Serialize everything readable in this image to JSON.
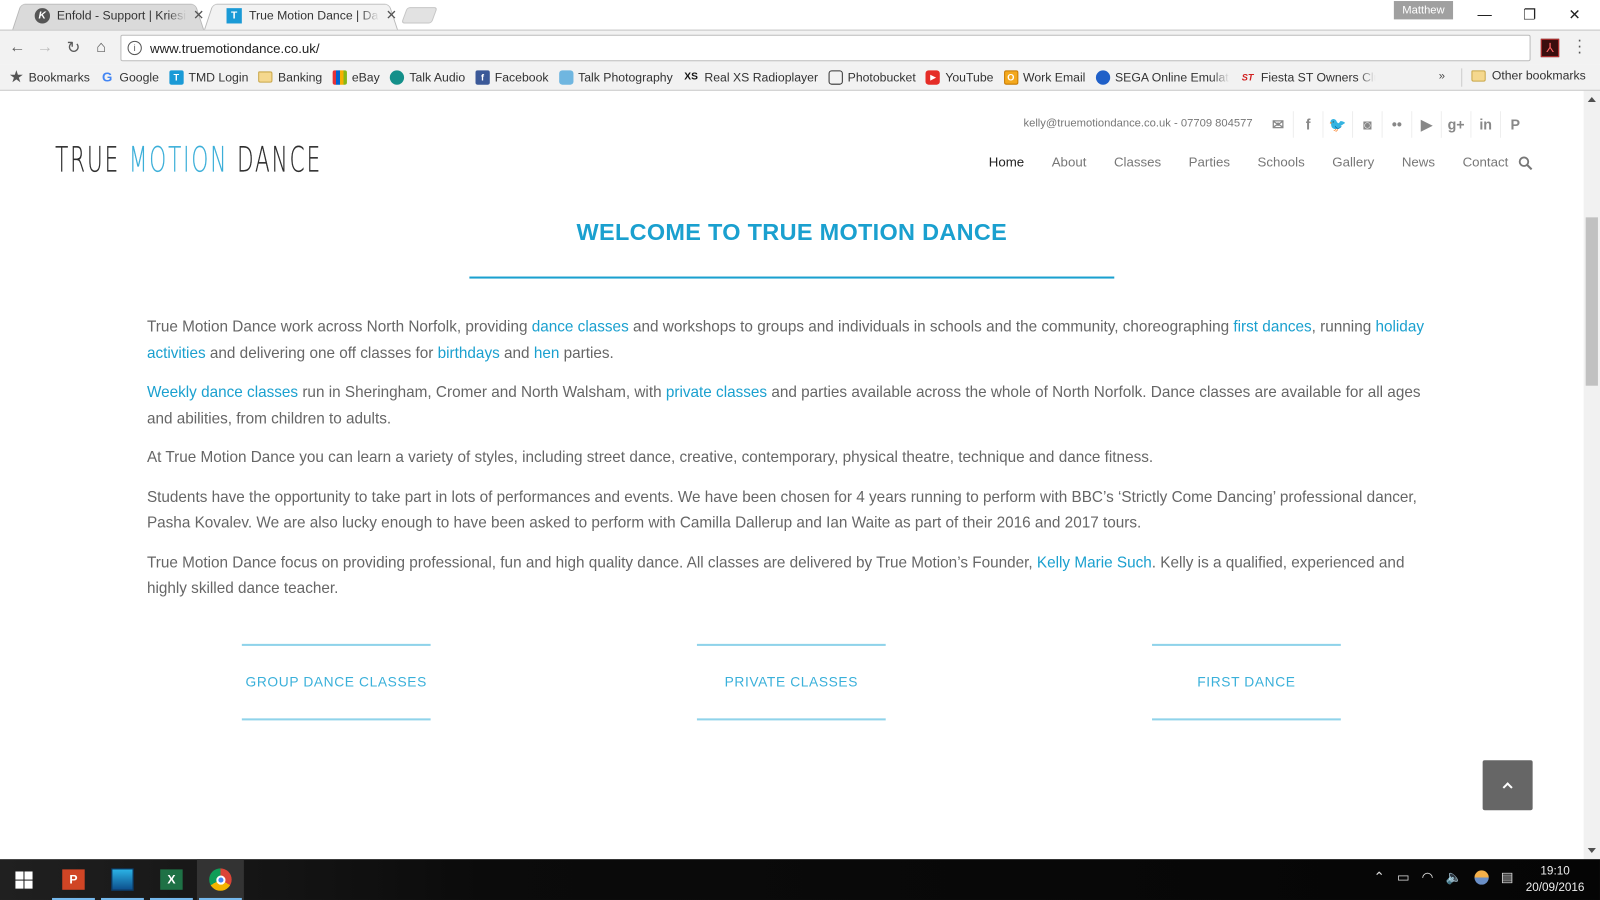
{
  "browser": {
    "tabs": [
      {
        "title": "Enfold - Support | Kriesi.at",
        "favicon": "kriesi-logo-icon",
        "active": false
      },
      {
        "title": "True Motion Dance | Dance",
        "favicon": "tmd-favicon-icon",
        "active": true
      }
    ],
    "profile_name": "Matthew",
    "url": "www.truemotiondance.co.uk/",
    "bookmarks": [
      {
        "label": "Bookmarks",
        "icon": "star-icon"
      },
      {
        "label": "Google",
        "icon": "google-icon"
      },
      {
        "label": "TMD Login",
        "icon": "tmd-icon"
      },
      {
        "label": "Banking",
        "icon": "folder-icon"
      },
      {
        "label": "eBay",
        "icon": "ebay-icon"
      },
      {
        "label": "Talk Audio",
        "icon": "talk-audio-icon"
      },
      {
        "label": "Facebook",
        "icon": "facebook-icon"
      },
      {
        "label": "Talk Photography",
        "icon": "camera-icon"
      },
      {
        "label": "Real XS Radioplayer",
        "icon": "xs-icon"
      },
      {
        "label": "Photobucket",
        "icon": "photobucket-icon"
      },
      {
        "label": "YouTube",
        "icon": "youtube-icon"
      },
      {
        "label": "Work Email",
        "icon": "outlook-icon"
      },
      {
        "label": "SEGA Online Emulator",
        "icon": "sonic-icon"
      },
      {
        "label": "Fiesta ST Owners Club",
        "icon": "st-icon"
      }
    ],
    "bookmarks_overflow": "»",
    "other_bookmarks": "Other bookmarks"
  },
  "site": {
    "logo": {
      "word1": "TRUE",
      "word2": "MOTION",
      "word3": "DANCE"
    },
    "contact": "kelly@truemotiondance.co.uk - 07709 804577",
    "social": [
      "mail-icon",
      "facebook-icon",
      "twitter-icon",
      "instagram-icon",
      "flickr-icon",
      "youtube-icon",
      "google-plus-icon",
      "linkedin-icon",
      "pinterest-icon"
    ],
    "social_glyphs": [
      "✉",
      "f",
      "🐦",
      "◙",
      "••",
      "▶",
      "g+",
      "in",
      "P"
    ],
    "nav": [
      {
        "label": "Home",
        "active": true
      },
      {
        "label": "About"
      },
      {
        "label": "Classes"
      },
      {
        "label": "Parties"
      },
      {
        "label": "Schools"
      },
      {
        "label": "Gallery"
      },
      {
        "label": "News"
      },
      {
        "label": "Contact"
      }
    ],
    "heading": "WELCOME TO TRUE MOTION DANCE",
    "paragraphs": [
      [
        {
          "t": "True Motion Dance work across North Norfolk, providing "
        },
        {
          "t": "dance classes",
          "link": true
        },
        {
          "t": " and workshops to groups and individuals in schools and the community, choreographing "
        },
        {
          "t": "first dances",
          "link": true
        },
        {
          "t": ", running "
        },
        {
          "t": "holiday activities",
          "link": true
        },
        {
          "t": " and delivering one off classes for "
        },
        {
          "t": "birthdays",
          "link": true
        },
        {
          "t": " and "
        },
        {
          "t": "hen",
          "link": true
        },
        {
          "t": " parties."
        }
      ],
      [
        {
          "t": "Weekly dance classes",
          "link": true
        },
        {
          "t": " run in Sheringham, Cromer and North Walsham, with "
        },
        {
          "t": "private classes",
          "link": true
        },
        {
          "t": " and parties available across the whole of North Norfolk. Dance classes are available for all ages and abilities, from children to adults."
        }
      ],
      [
        {
          "t": "At True Motion Dance you can learn a variety of styles, including street dance, creative, contemporary, physical theatre, technique and dance fitness."
        }
      ],
      [
        {
          "t": "Students have the opportunity to take part in lots of performances and events. We have been chosen for 4 years running to perform with BBC’s ‘Strictly Come Dancing’ professional dancer, Pasha Kovalev. We are also lucky enough to have been asked to perform with Camilla Dallerup and Ian Waite as part of their 2016 and 2017 tours."
        }
      ],
      [
        {
          "t": "True Motion Dance focus on providing professional, fun and high quality dance. All classes are delivered by True Motion’s Founder, "
        },
        {
          "t": "Kelly Marie Such",
          "link": true
        },
        {
          "t": ". Kelly is a qualified, experienced and highly skilled dance teacher."
        }
      ]
    ],
    "ctas": [
      "GROUP DANCE CLASSES",
      "PRIVATE CLASSES",
      "FIRST DANCE"
    ],
    "colors": {
      "accent": "#1aa0cf",
      "text": "#666666",
      "cta_line": "#8fd3ea"
    }
  },
  "taskbar": {
    "apps": [
      "start-icon",
      "powerpoint-icon",
      "movie-maker-icon",
      "excel-icon",
      "chrome-icon"
    ],
    "time": "19:10",
    "date": "20/09/2016"
  }
}
